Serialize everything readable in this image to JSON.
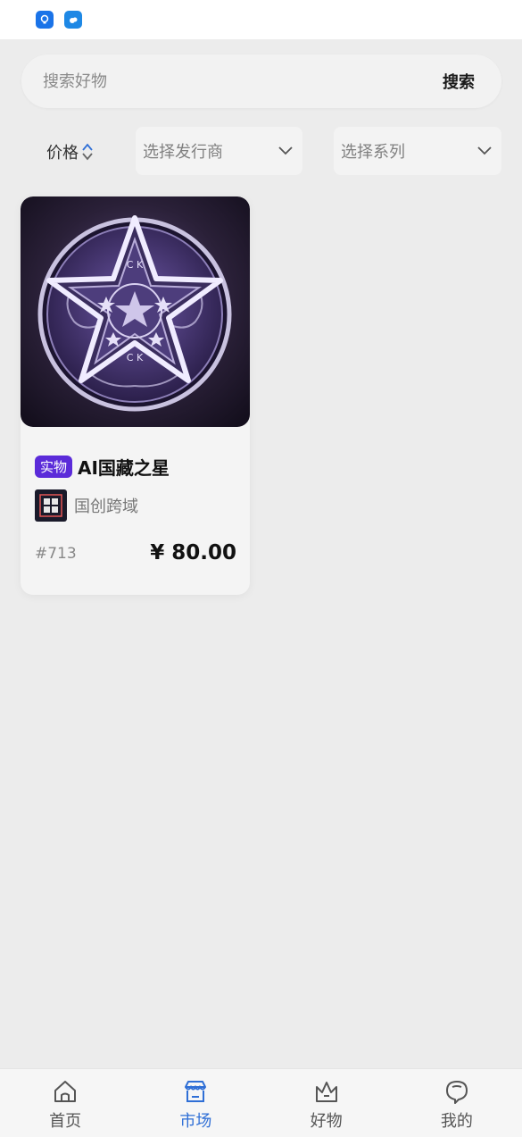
{
  "search": {
    "placeholder": "搜索好物",
    "button_label": "搜索"
  },
  "filters": {
    "price_label": "价格",
    "issuer_placeholder": "选择发行商",
    "series_placeholder": "选择系列"
  },
  "products": [
    {
      "tag": "实物",
      "title": "AI国藏之星",
      "issuer": "国创跨域",
      "serial": "#713",
      "price": "¥ 80.00"
    }
  ],
  "tabbar": {
    "items": [
      {
        "label": "首页",
        "icon": "home-icon",
        "active": false
      },
      {
        "label": "市场",
        "icon": "store-icon",
        "active": true
      },
      {
        "label": "好物",
        "icon": "crown-icon",
        "active": false
      },
      {
        "label": "我的",
        "icon": "profile-icon",
        "active": false
      }
    ]
  },
  "colors": {
    "accent": "#2f6fd6",
    "tag_bg": "#5b2bd9",
    "background": "#ececec"
  }
}
